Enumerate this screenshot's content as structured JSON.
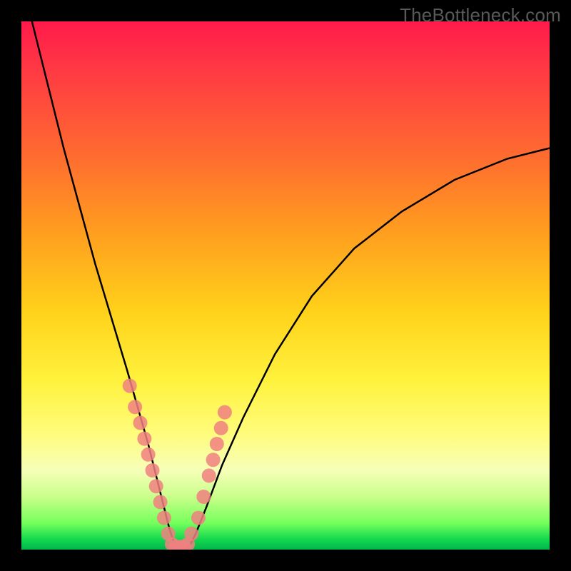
{
  "watermark": "TheBottleneck.com",
  "colors": {
    "frame": "#000000",
    "gradient_top": "#ff1a4b",
    "gradient_bottom": "#01b64a",
    "curve": "#000000",
    "marker": "#f08080"
  },
  "chart_data": {
    "type": "line",
    "title": "",
    "xlabel": "",
    "ylabel": "",
    "xlim": [
      0,
      100
    ],
    "ylim": [
      0,
      100
    ],
    "grid": false,
    "legend": false,
    "series": [
      {
        "name": "bottleneck-curve",
        "x": [
          2,
          5,
          8,
          11,
          14,
          17,
          20,
          22,
          24,
          25,
          26,
          27,
          28,
          29,
          30,
          31,
          32,
          33,
          35,
          38,
          42,
          48,
          55,
          63,
          72,
          82,
          92,
          100
        ],
        "y": [
          100,
          88,
          76,
          65,
          54,
          44,
          34,
          27,
          20,
          16,
          12,
          8,
          4,
          1,
          0,
          0,
          1,
          3,
          8,
          16,
          25,
          37,
          48,
          57,
          64,
          70,
          74,
          76
        ]
      }
    ],
    "markers": {
      "name": "highlighted-points",
      "color": "#f08080",
      "x_ranges": [
        [
          20,
          28
        ],
        [
          31,
          38
        ]
      ],
      "points": [
        {
          "x": 20.5,
          "y": 31
        },
        {
          "x": 21.5,
          "y": 27
        },
        {
          "x": 22.5,
          "y": 24
        },
        {
          "x": 23.3,
          "y": 21
        },
        {
          "x": 24.0,
          "y": 18
        },
        {
          "x": 24.8,
          "y": 15
        },
        {
          "x": 25.5,
          "y": 12
        },
        {
          "x": 26.3,
          "y": 9
        },
        {
          "x": 27.0,
          "y": 6
        },
        {
          "x": 27.8,
          "y": 3
        },
        {
          "x": 28.5,
          "y": 1
        },
        {
          "x": 29.2,
          "y": 0.5
        },
        {
          "x": 30.0,
          "y": 0.5
        },
        {
          "x": 30.8,
          "y": 0.5
        },
        {
          "x": 31.5,
          "y": 1
        },
        {
          "x": 32.2,
          "y": 3
        },
        {
          "x": 33.5,
          "y": 6
        },
        {
          "x": 34.5,
          "y": 10
        },
        {
          "x": 35.5,
          "y": 14
        },
        {
          "x": 36.3,
          "y": 17
        },
        {
          "x": 37.0,
          "y": 20
        },
        {
          "x": 37.8,
          "y": 23
        },
        {
          "x": 38.5,
          "y": 26
        }
      ]
    }
  }
}
